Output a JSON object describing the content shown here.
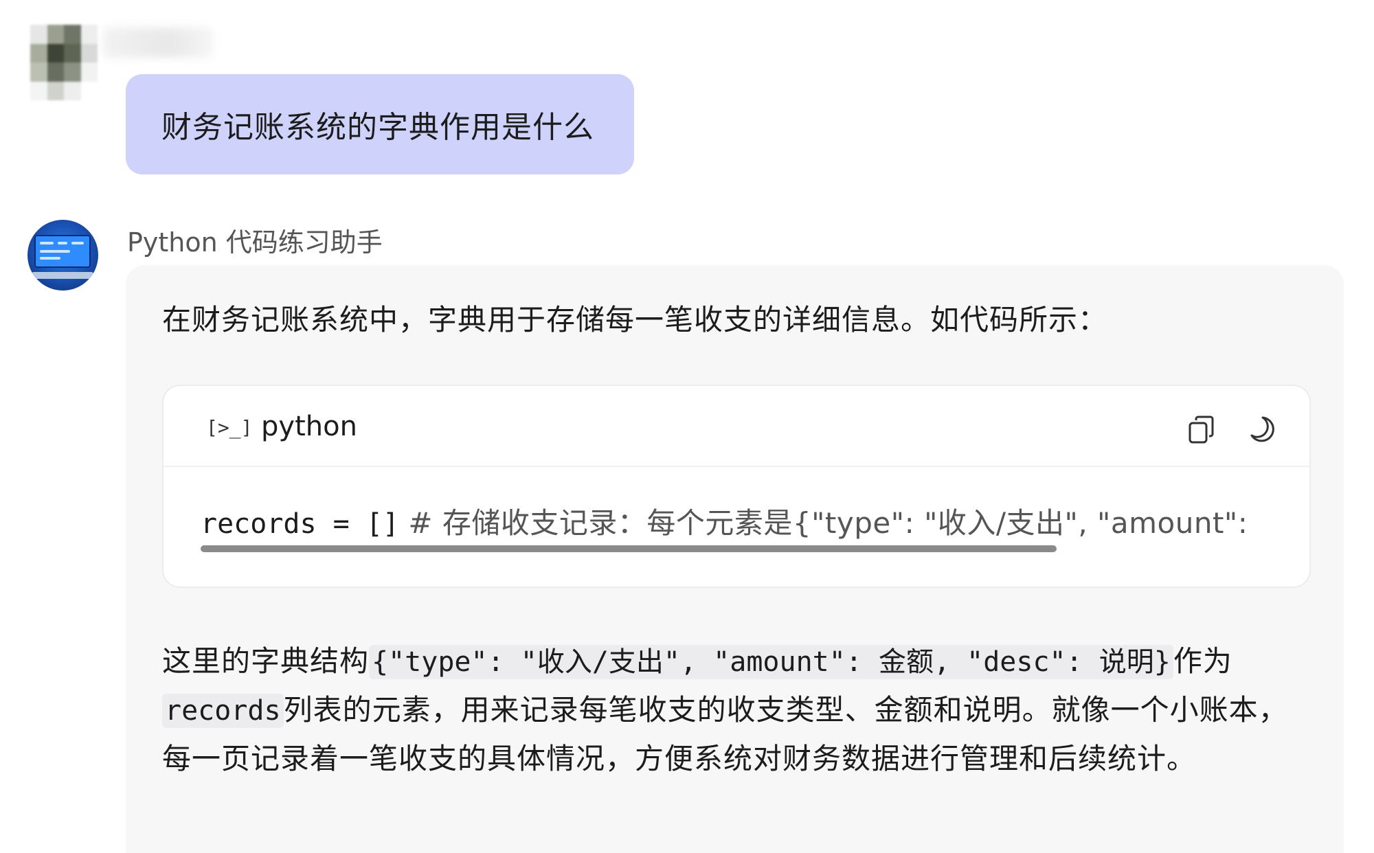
{
  "user_message": {
    "text": "财务记账系统的字典作用是什么"
  },
  "assistant": {
    "name": "Python 代码练习助手",
    "intro": "在财务记账系统中，字典用于存储每一笔收支的详细信息。如代码所示：",
    "code_block": {
      "language": "python",
      "terminal_icon": "[>_]",
      "code_part": "records = []",
      "comment_part": "# 存储收支记录：每个元素是{\"type\": \"收入/支出\", \"amount\":"
    },
    "explanation": {
      "p1": "这里的字典结构",
      "code1": "{\"type\": \"收入/支出\", \"amount\": 金额, \"desc\": 说明}",
      "p2": "作为",
      "code2": "records",
      "p3": "列表的元素，用来记录每笔收支的收支类型、金额和说明。就像一个小账本，每一页记录着一笔收支的具体情况，方便系统对财务数据进行管理和后续统计。"
    }
  },
  "icons": [
    "copy-icon",
    "theme-toggle-icon",
    "terminal-icon"
  ],
  "colors": {
    "user_bubble": "#cfd3fb",
    "assistant_card": "#f7f7f8",
    "code_bg": "#ffffff"
  }
}
